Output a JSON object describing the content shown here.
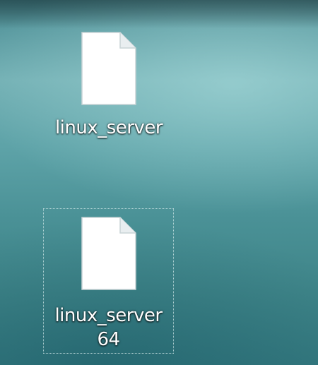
{
  "desktop": {
    "icons": [
      {
        "label": "linux_server",
        "icon": "blank-file-icon",
        "selected": false
      },
      {
        "label_line1": "linux_server",
        "label_line2": "64",
        "icon": "blank-file-icon",
        "selected": true
      }
    ]
  }
}
